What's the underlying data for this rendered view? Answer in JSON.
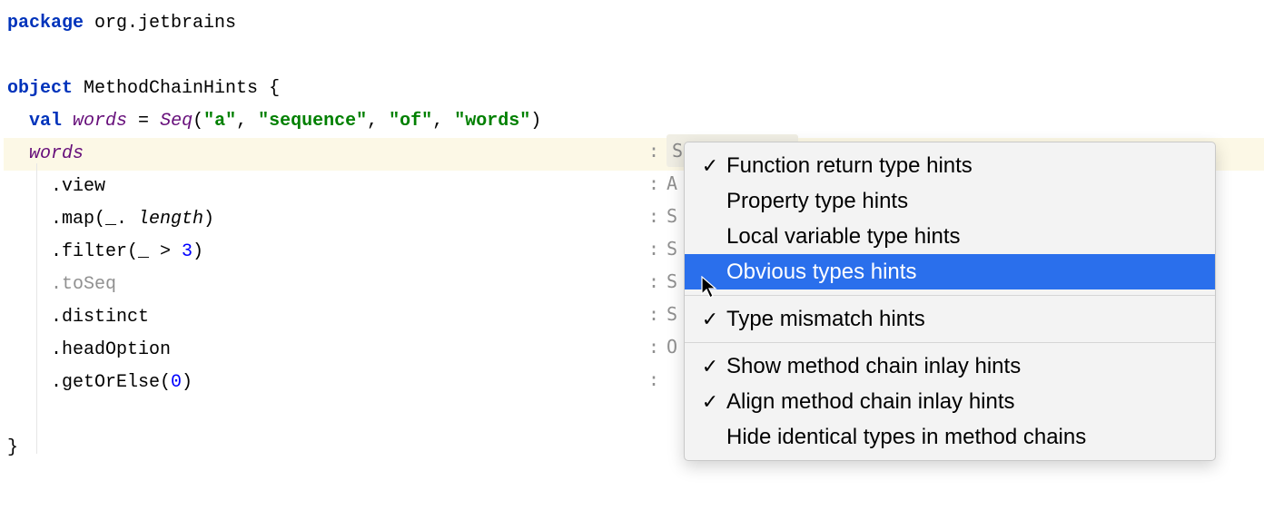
{
  "code": {
    "package_kw": "package",
    "package_name": "org.jetbrains",
    "object_kw": "object",
    "object_name": "MethodChainHints",
    "brace_open": "{",
    "val_kw": "val",
    "val_name": "words",
    "eq": " = ",
    "seq_call": "Seq",
    "seq_args_open": "(",
    "str1": "\"a\"",
    "comma": ", ",
    "str2": "\"sequence\"",
    "str3": "\"of\"",
    "str4": "\"words\"",
    "seq_args_close": ")",
    "words_ref": "words",
    "chain": {
      "view": ".view",
      "map_open": ".map(",
      "map_arg": "_.",
      "map_arg2": " length",
      "map_close": ")",
      "filter_open": ".filter(",
      "filter_arg1": "_ > ",
      "filter_num": "3",
      "filter_close": ")",
      "toSeq": ".toSeq",
      "distinct": ".distinct",
      "headOption": ".headOption",
      "getOrElse_open": ".getOrElse(",
      "getOrElse_num": "0",
      "getOrElse_close": ")"
    },
    "brace_close": "}"
  },
  "hints": {
    "rows": [
      {
        "prefix": ":",
        "text": "Seq[String]"
      },
      {
        "prefix": ":",
        "text": "A"
      },
      {
        "prefix": ":",
        "text": "S"
      },
      {
        "prefix": ":",
        "text": "S"
      },
      {
        "prefix": ":",
        "text": "S"
      },
      {
        "prefix": ":",
        "text": "S"
      },
      {
        "prefix": ":",
        "text": "O"
      },
      {
        "prefix": ":",
        "text": ""
      }
    ]
  },
  "menu": {
    "items": [
      {
        "label": "Function return type hints",
        "checked": true,
        "selected": false
      },
      {
        "label": "Property type hints",
        "checked": false,
        "selected": false
      },
      {
        "label": "Local variable type hints",
        "checked": false,
        "selected": false
      },
      {
        "label": "Obvious types hints",
        "checked": false,
        "selected": true
      }
    ],
    "group2": [
      {
        "label": "Type mismatch hints",
        "checked": true,
        "selected": false
      }
    ],
    "group3": [
      {
        "label": "Show method chain inlay hints",
        "checked": true,
        "selected": false
      },
      {
        "label": "Align method chain inlay hints",
        "checked": true,
        "selected": false
      },
      {
        "label": "Hide identical types in method chains",
        "checked": false,
        "selected": false
      }
    ]
  },
  "check_glyph": "✓"
}
